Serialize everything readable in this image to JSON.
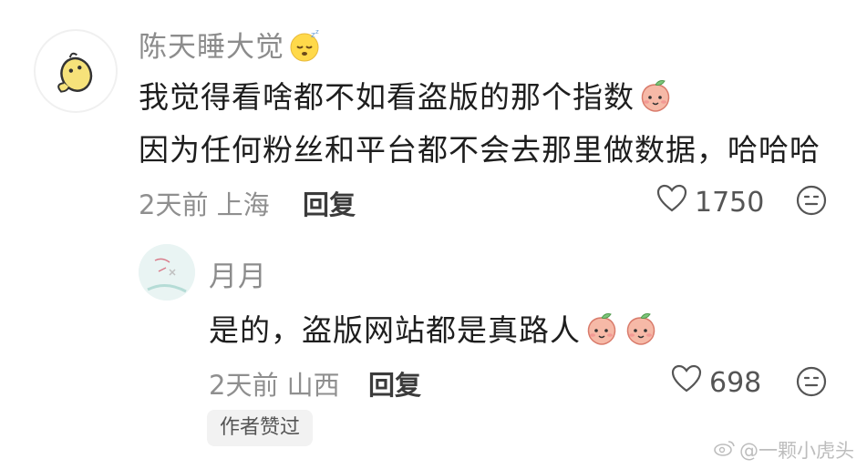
{
  "main_comment": {
    "username": "陈天睡大觉",
    "line1": "我觉得看啥都不如看盗版的那个指数",
    "line2": "因为任何粉丝和平台都不会去那里做数据，哈哈哈",
    "time_location": "2天前 上海",
    "reply_label": "回复",
    "like_count": "1750"
  },
  "reply_comment": {
    "username": "月月",
    "text": "是的，盗版网站都是真路人",
    "time_location": "2天前 山西",
    "reply_label": "回复",
    "like_count": "698",
    "badge": "作者赞过"
  },
  "watermark": "@一颗小虎头",
  "icons": {
    "like": "heart-outline-icon",
    "emoji_react": "smiley-face-icon",
    "sleepy": "sleepy-face-emoji",
    "peach": "peach-emoji"
  }
}
